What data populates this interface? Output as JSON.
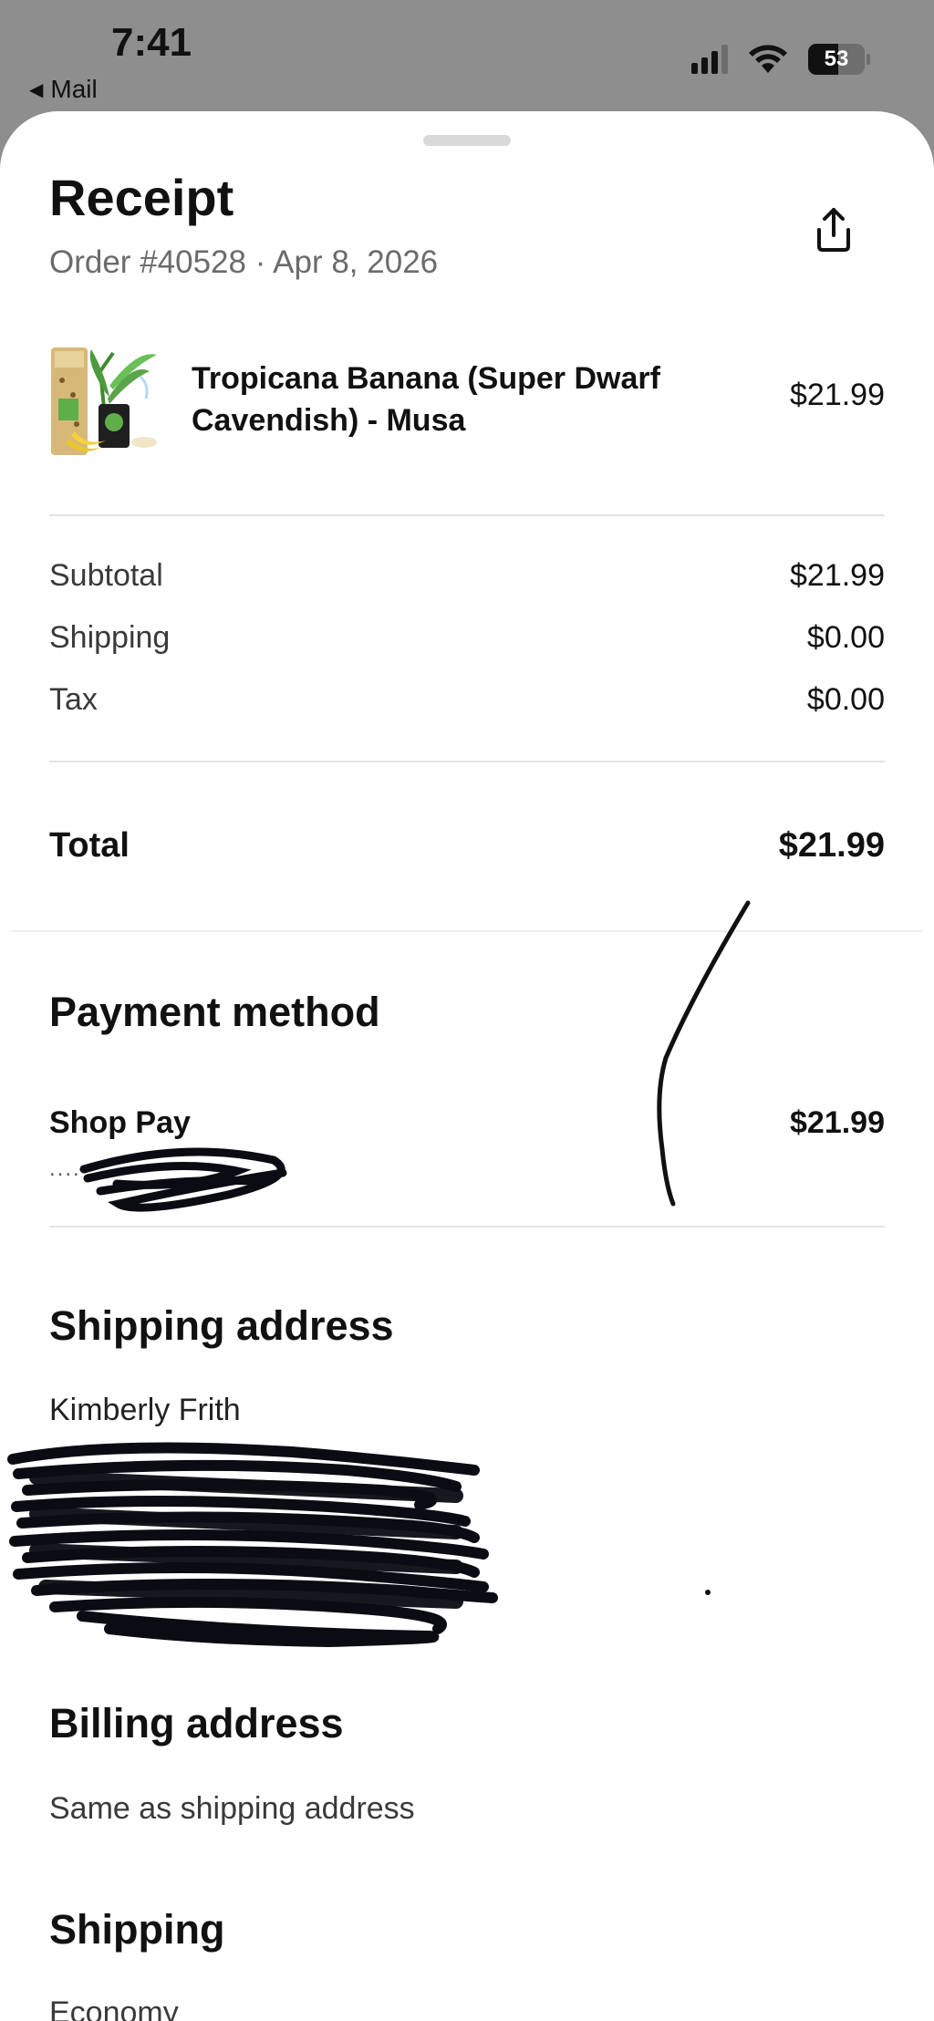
{
  "status_bar": {
    "time": "7:41",
    "back_label": "Mail",
    "battery": "53",
    "battery_level": 0.53
  },
  "receipt": {
    "title": "Receipt",
    "subtitle": "Order #40528 · Apr 8, 2026"
  },
  "line_items": [
    {
      "name": "Tropicana Banana (Super Dwarf Cavendish) - Musa",
      "price": "$21.99"
    }
  ],
  "summary": {
    "subtotal_label": "Subtotal",
    "subtotal_value": "$21.99",
    "shipping_label": "Shipping",
    "shipping_value": "$0.00",
    "tax_label": "Tax",
    "tax_value": "$0.00",
    "total_label": "Total",
    "total_value": "$21.99"
  },
  "payment": {
    "heading": "Payment method",
    "method_name": "Shop Pay",
    "masked_card": "....",
    "amount": "$21.99"
  },
  "shipping_address": {
    "heading": "Shipping address",
    "name": "Kimberly Frith"
  },
  "billing_address": {
    "heading": "Billing address",
    "text": "Same as shipping address"
  },
  "shipping": {
    "heading": "Shipping",
    "method": "Economy"
  },
  "colors": {
    "backdrop": "#8e8e8e",
    "sheet": "#ffffff",
    "text_primary": "#111111",
    "text_secondary": "#6b6b6b",
    "divider": "#e4e4e4"
  },
  "icons": {
    "share": "share-icon",
    "back": "back-arrow-icon"
  }
}
